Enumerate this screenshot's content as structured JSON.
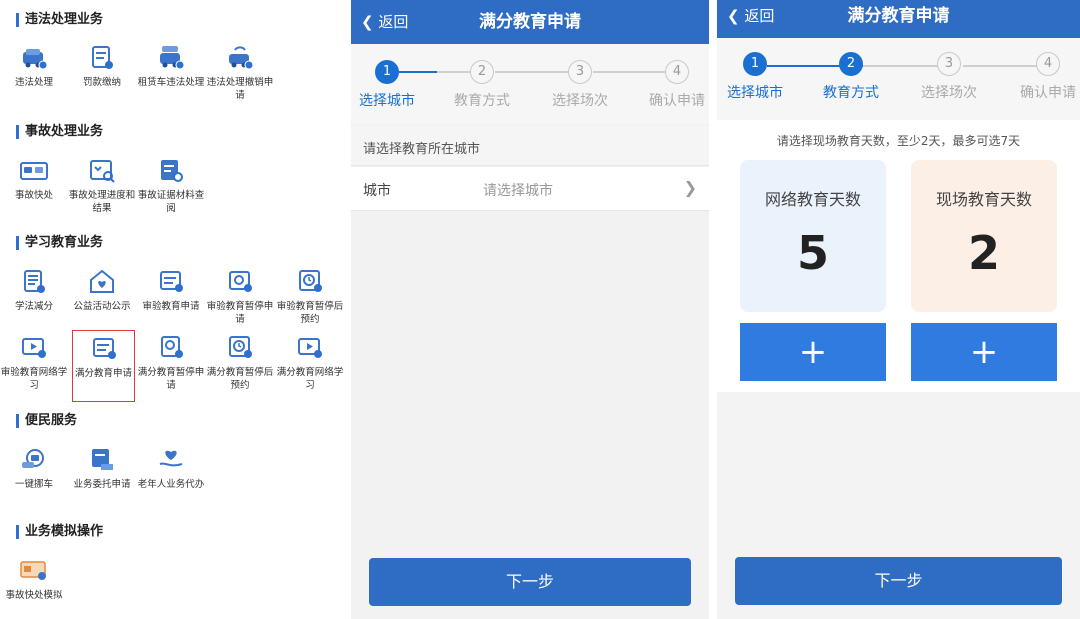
{
  "left": {
    "sections": [
      {
        "title": "违法处理业务",
        "items": [
          "违法处理",
          "罚款缴纳",
          "租赁车违法处理",
          "违法处理撤销申请"
        ]
      },
      {
        "title": "事故处理业务",
        "items": [
          "事故快处",
          "事故处理进度和结果",
          "事故证据材料查阅"
        ]
      },
      {
        "title": "学习教育业务",
        "items": [
          "学法减分",
          "公益活动公示",
          "审验教育申请",
          "审验教育暂停申请",
          "审验教育暂停后预约",
          "审验教育网络学习",
          "满分教育申请",
          "满分教育暂停申请",
          "满分教育暂停后预约",
          "满分教育网络学习"
        ]
      },
      {
        "title": "便民服务",
        "items": [
          "一键挪车",
          "业务委托申请",
          "老年人业务代办"
        ]
      },
      {
        "title": "业务模拟操作",
        "items": [
          "事故快处模拟"
        ]
      }
    ]
  },
  "mid": {
    "back": "返回",
    "title": "满分教育申请",
    "steps": [
      {
        "num": "1",
        "label": "选择城市"
      },
      {
        "num": "2",
        "label": "教育方式"
      },
      {
        "num": "3",
        "label": "选择场次"
      },
      {
        "num": "4",
        "label": "确认申请"
      }
    ],
    "section_title": "请选择教育所在城市",
    "city_label": "城市",
    "city_placeholder": "请选择城市",
    "next": "下一步"
  },
  "right": {
    "back": "返回",
    "title": "满分教育申请",
    "steps": [
      {
        "num": "1",
        "label": "选择城市"
      },
      {
        "num": "2",
        "label": "教育方式"
      },
      {
        "num": "3",
        "label": "选择场次"
      },
      {
        "num": "4",
        "label": "确认申请"
      }
    ],
    "hint": "请选择现场教育天数，至少2天，最多可选7天",
    "online_label": "网络教育天数",
    "online_days": "5",
    "onsite_label": "现场教育天数",
    "onsite_days": "2",
    "plus": "+",
    "next": "下一步"
  },
  "colors": {
    "brand": "#2f6cc4",
    "accent": "#1a6fd1",
    "online_card": "#eaf2fc",
    "onsite_card": "#fcefe6"
  }
}
